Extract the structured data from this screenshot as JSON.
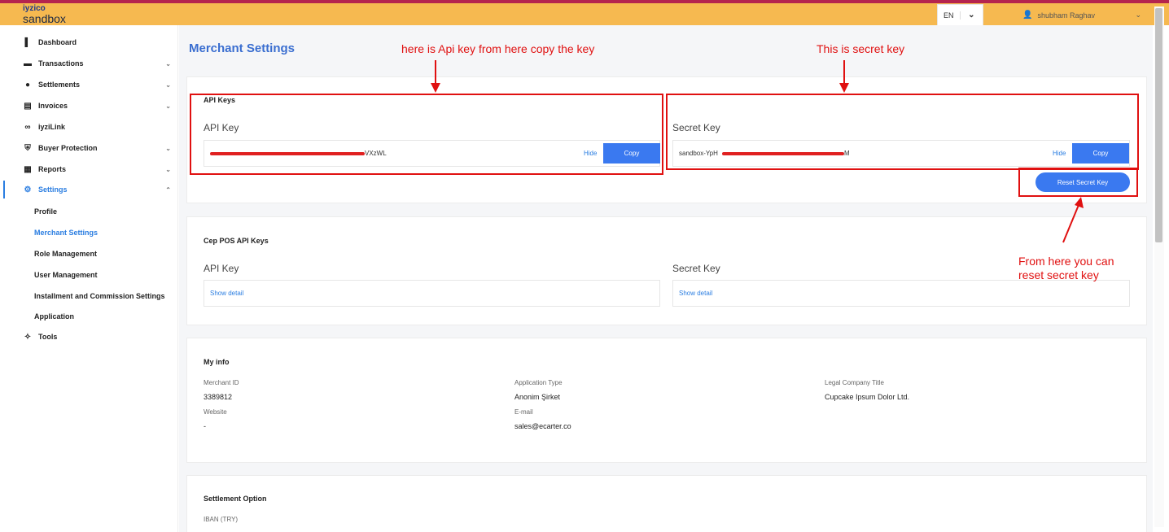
{
  "brand": {
    "line1": "iyzico",
    "line2": "sandbox"
  },
  "header": {
    "language": "EN",
    "user_name": "shubham Raghav"
  },
  "sidebar": {
    "items": [
      {
        "label": "Dashboard",
        "icon": "bar-chart-icon",
        "expandable": false
      },
      {
        "label": "Transactions",
        "icon": "card-icon",
        "expandable": true
      },
      {
        "label": "Settlements",
        "icon": "coin-icon",
        "expandable": true
      },
      {
        "label": "Invoices",
        "icon": "invoice-icon",
        "expandable": true
      },
      {
        "label": "iyziLink",
        "icon": "link-icon",
        "expandable": false
      },
      {
        "label": "Buyer Protection",
        "icon": "shield-icon",
        "expandable": true
      },
      {
        "label": "Reports",
        "icon": "reports-icon",
        "expandable": true
      },
      {
        "label": "Settings",
        "icon": "gear-icon",
        "expandable": true,
        "active": true
      },
      {
        "label": "Tools",
        "icon": "puzzle-icon",
        "expandable": false
      }
    ],
    "settings_sub": [
      {
        "label": "Profile"
      },
      {
        "label": "Merchant Settings",
        "active": true
      },
      {
        "label": "Role Management"
      },
      {
        "label": "User Management"
      },
      {
        "label": "Installment and Commission Settings"
      },
      {
        "label": "Application"
      }
    ]
  },
  "main": {
    "title": "Merchant Settings",
    "api_keys": {
      "section_title": "API Keys",
      "api_key_label": "API Key",
      "api_key_value_suffix": "VXzWL",
      "secret_key_label": "Secret Key",
      "secret_key_value_prefix": "sandbox-YpH",
      "secret_key_value_suffix": "M",
      "hide_label": "Hide",
      "copy_label": "Copy",
      "reset_label": "Reset Secret Key"
    },
    "cep_pos": {
      "section_title": "Cep POS API Keys",
      "api_key_label": "API Key",
      "secret_key_label": "Secret Key",
      "show_detail": "Show detail"
    },
    "my_info": {
      "section_title": "My info",
      "merchant_id_label": "Merchant ID",
      "merchant_id": "3389812",
      "application_type_label": "Application Type",
      "application_type": "Anonim Şirket",
      "legal_title_label": "Legal Company Title",
      "legal_title": "Cupcake Ipsum Dolor Ltd.",
      "website_label": "Website",
      "website": "-",
      "email_label": "E-mail",
      "email": "sales@ecarter.co"
    },
    "settlement": {
      "section_title": "Settlement Option",
      "iban_label": "IBAN (TRY)"
    }
  },
  "annotations": {
    "api_key_note": "here is Api key  from here copy the key",
    "secret_key_note": "This is secret key",
    "reset_note_line1": "From here you can",
    "reset_note_line2": "reset secret key",
    "color": "#e01010"
  },
  "colors": {
    "accent": "#3a79f0",
    "topbar": "#f6b950",
    "topline": "#b5244e",
    "link": "#2a7de1"
  }
}
